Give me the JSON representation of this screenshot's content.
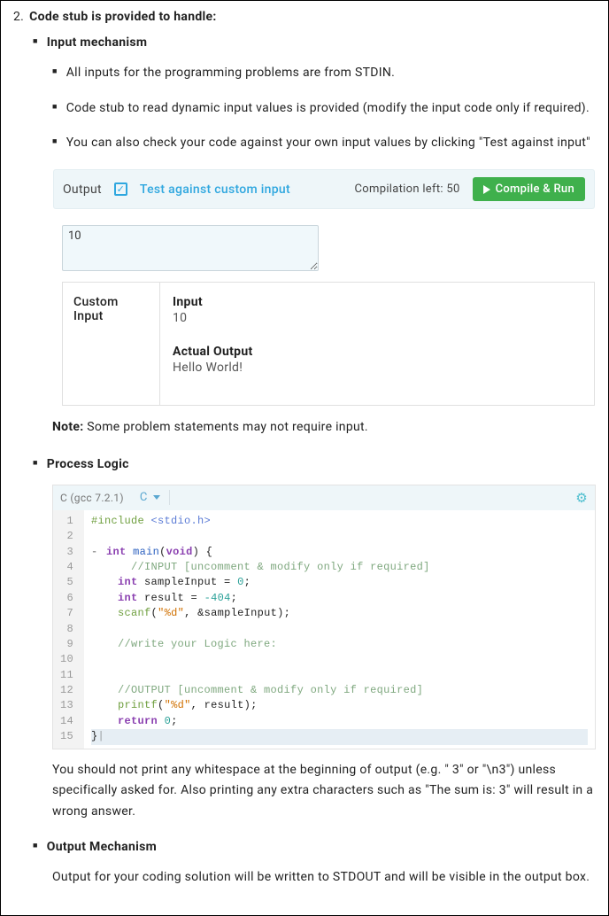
{
  "heading": {
    "num": "2.",
    "text": "Code stub is provided to handle:"
  },
  "sections": {
    "input_mechanism": {
      "title": "Input mechanism",
      "bullets": [
        "All inputs for the programming problems are from STDIN.",
        "Code stub to read dynamic input values is provided (modify the input code only if required).",
        "You can also check your code against your own input values by clicking \"Test against input\""
      ]
    },
    "process_logic": {
      "title": "Process Logic",
      "note": "You should not print any whitespace at the beginning of output (e.g. \" 3\" or \"\\n3\") unless specifically asked for. Also printing any extra characters such as \"The sum is: 3\" will result in a wrong answer."
    },
    "output_mechanism": {
      "title": "Output Mechanism",
      "text": "Output for your coding solution will be written to STDOUT and will be visible in the output box."
    }
  },
  "output_panel": {
    "output_label": "Output",
    "checkbox_checked": true,
    "test_link": "Test against custom input",
    "compilation_left": "Compilation left: 50",
    "run_button": "Compile & Run",
    "textarea_value": "10",
    "custom_input_label": "Custom Input",
    "input_heading": "Input",
    "input_value": "10",
    "actual_output_heading": "Actual Output",
    "actual_output_value": "Hello World!"
  },
  "note": {
    "label": "Note:",
    "text": " Some problem statements may not require input."
  },
  "editor": {
    "compiler": "C (gcc 7.2.1)",
    "language_short": "C",
    "gear_icon": "gear",
    "lines": [
      {
        "n": "1",
        "f": "",
        "html": "<span class='tk-pre'>#include</span> <span class='tk-inc'>&lt;stdio.h&gt;</span>"
      },
      {
        "n": "2",
        "f": "",
        "html": ""
      },
      {
        "n": "3",
        "f": "-",
        "html": "<span class='tk-kw'>int</span> <span class='tk-fn'>main</span>(<span class='tk-kw'>void</span>) {"
      },
      {
        "n": "4",
        "f": "",
        "html": "      <span class='tk-cm'>//INPUT [uncomment &amp; modify only if required]</span>"
      },
      {
        "n": "5",
        "f": "",
        "html": "    <span class='tk-kw'>int</span> sampleInput = <span class='tk-num'>0</span>;"
      },
      {
        "n": "6",
        "f": "",
        "html": "    <span class='tk-kw'>int</span> result = <span class='tk-num'>-404</span>;"
      },
      {
        "n": "7",
        "f": "",
        "html": "    <span class='tk-pre'>scanf</span>(<span class='tk-str'>\"%d\"</span>, &amp;sampleInput);"
      },
      {
        "n": "8",
        "f": "",
        "html": ""
      },
      {
        "n": "9",
        "f": "",
        "html": "    <span class='tk-cm'>//write your Logic here:</span>"
      },
      {
        "n": "10",
        "f": "",
        "html": ""
      },
      {
        "n": "11",
        "f": "",
        "html": ""
      },
      {
        "n": "12",
        "f": "",
        "html": "    <span class='tk-cm'>//OUTPUT [uncomment &amp; modify only if required]</span>"
      },
      {
        "n": "13",
        "f": "",
        "html": "    <span class='tk-pre'>printf</span>(<span class='tk-str'>\"%d\"</span>, result);"
      },
      {
        "n": "14",
        "f": "",
        "html": "    <span class='tk-kw'>return</span> <span class='tk-num'>0</span>;"
      },
      {
        "n": "15",
        "f": "",
        "html": "}<span style='opacity:.4'>|</span>",
        "hl": true
      }
    ]
  }
}
